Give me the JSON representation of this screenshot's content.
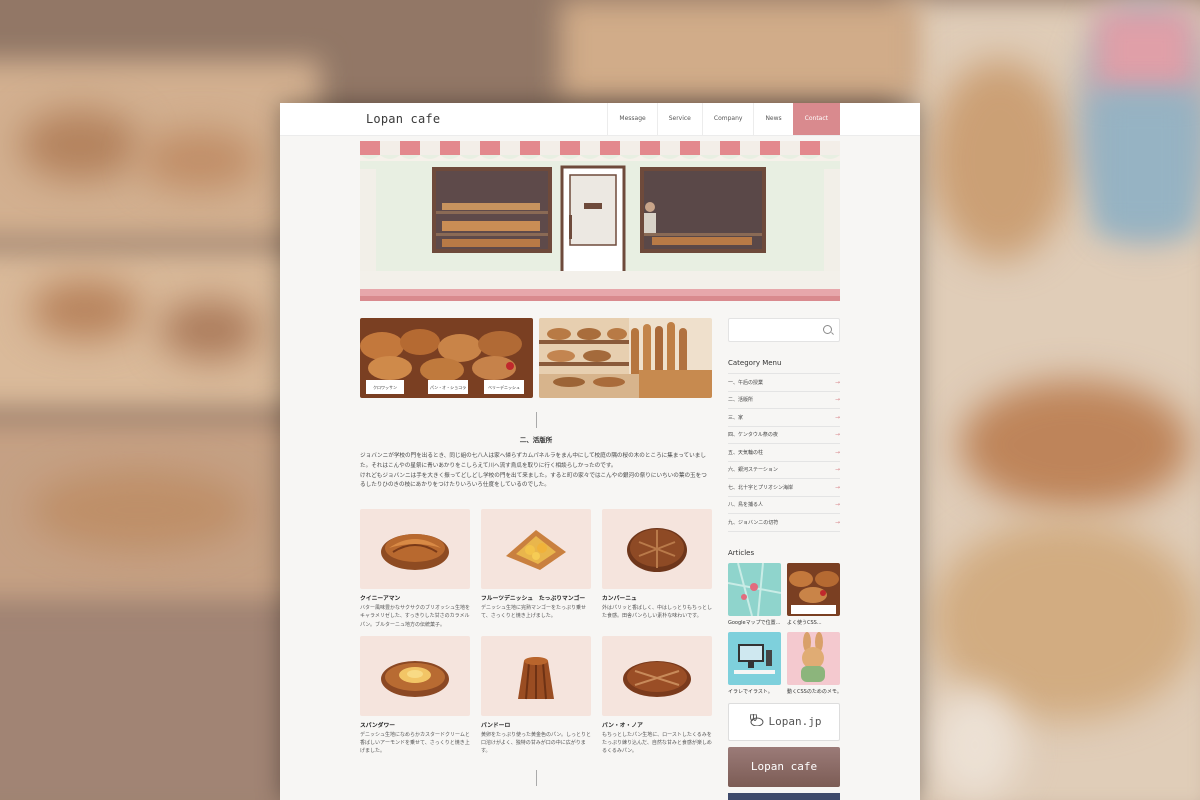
{
  "header": {
    "logo": "Lopan cafe",
    "nav": [
      "Message",
      "Service",
      "Company",
      "News",
      "Contact"
    ]
  },
  "main": {
    "photo_labels": [
      "クロワッサン",
      "パン・オ・ショコラ",
      "ベリーデニッシュ"
    ],
    "section": {
      "title": "二、活版所",
      "paragraph_1": "ジョバンニが学校の門を出るとき、同じ組の七八人は家へ帰らずカムパネルラをまん中にして校庭の隅の桜の木のところに集まっていました。それはこんやの星祭に青いあかりをこしらえて川へ流す烏瓜を取りに行く相談らしかったのです。",
      "paragraph_2": "けれどもジョバンニは手を大きく振ってどしどし学校の門を出て来ました。すると町の家々ではこんやの銀河の祭りにいちいの葉の玉をつるしたりひのきの枝にあかりをつけたりいろいろ仕度をしているのでした。"
    },
    "products": [
      {
        "name": "クイニーアマン",
        "desc": "バター風味豊かなサクサクのブリオッシュ生地をキャラメリゼした、すっきりした甘さのカラメルパン。ブルターニュ地方の伝統菓子。"
      },
      {
        "name": "フルーツデニッシュ　たっぷりマンゴー",
        "desc": "デニッシュ生地に完熟マンゴーをたっぷり乗せて、さっくりと焼き上げました。"
      },
      {
        "name": "カンパーニュ",
        "desc": "外はパリッと香ばしく、中はしっとりもちっとした食感。田舎パンらしい素朴な味わいです。"
      },
      {
        "name": "スパンダワー",
        "desc": "デニッシュ生地になめらかカスタードクリームと香ばしいアーモンドを乗せて、さっくりと焼き上げました。"
      },
      {
        "name": "パンドーロ",
        "desc": "黄卵をたっぷり使った黄金色のパン。しっとりと口溶けがよく、独特の甘みが口の中に広がります。"
      },
      {
        "name": "パン・オ・ノア",
        "desc": "もちっとしたパン生地に、ローストしたくるみをたっぷり練り込んだ、自然な甘みと食感が楽しめるくるみパン。"
      }
    ]
  },
  "sidebar": {
    "search_placeholder": "",
    "category_heading": "Category Menu",
    "categories": [
      "一、午后の授業",
      "二、活版所",
      "三、家",
      "四、ケンタウル祭の夜",
      "五、天気輪の柱",
      "六、銀河ステーション",
      "七、北十字とプリオシン海岸",
      "八、鳥を捕る人",
      "九、ジョバンニの切符"
    ],
    "articles_heading": "Articles",
    "articles": [
      "Googleマップで位置...",
      "よく使うCSS...",
      "イラレでイラスト。",
      "動くCSSのためのメモ。"
    ],
    "banner_1": "Lopan.jp",
    "banner_2": "Lopan cafe"
  },
  "colors": {
    "accent": "#d98a8e",
    "page_bg": "#f7f6f4",
    "card_bg": "#f5e4dd"
  }
}
